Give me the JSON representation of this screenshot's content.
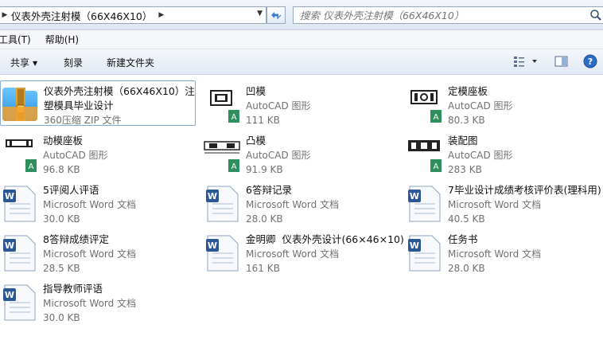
{
  "address": {
    "path_label": "仪表外壳注射模（66X46X10）",
    "search_placeholder": "搜索 仪表外壳注射模（66X46X10）"
  },
  "menu": [
    {
      "label": "工具(T)"
    },
    {
      "label": "帮助(H)"
    }
  ],
  "commands": {
    "share": "共享",
    "burn": "刻录",
    "new_folder": "新建文件夹"
  },
  "files": [
    {
      "name": "仪表外壳注射模（66X46X10）注塑模具毕业设计",
      "type": "360压缩 ZIP 文件",
      "size": "",
      "icon": "zip-archive-icon"
    },
    {
      "name": "凹模",
      "type": "AutoCAD 图形",
      "size": "111 KB",
      "icon": "autocad-drawing-icon"
    },
    {
      "name": "定模座板",
      "type": "AutoCAD 图形",
      "size": "80.3 KB",
      "icon": "autocad-drawing-icon"
    },
    {
      "name": "动模座板",
      "type": "AutoCAD 图形",
      "size": "96.8 KB",
      "icon": "autocad-drawing-icon"
    },
    {
      "name": "凸模",
      "type": "AutoCAD 图形",
      "size": "91.9 KB",
      "icon": "autocad-drawing-icon"
    },
    {
      "name": "装配图",
      "type": "AutoCAD 图形",
      "size": "283 KB",
      "icon": "autocad-drawing-icon"
    },
    {
      "name": "5评阅人评语",
      "type": "Microsoft Word 文档",
      "size": "30.0 KB",
      "icon": "word-document-icon"
    },
    {
      "name": "6答辩记录",
      "type": "Microsoft Word 文档",
      "size": "28.0 KB",
      "icon": "word-document-icon"
    },
    {
      "name": "7毕业设计成绩考核评价表(理科用)",
      "type": "Microsoft Word 文档",
      "size": "40.5 KB",
      "icon": "word-document-icon"
    },
    {
      "name": "8答辩成绩评定",
      "type": "Microsoft Word 文档",
      "size": "28.5 KB",
      "icon": "word-document-icon"
    },
    {
      "name": "金明卿  仪表外壳设计(66×46×10)",
      "type": "Microsoft Word 文档",
      "size": "161 KB",
      "icon": "word-document-icon"
    },
    {
      "name": "任务书",
      "type": "Microsoft Word 文档",
      "size": "28.0 KB",
      "icon": "word-document-icon"
    },
    {
      "name": "指导教师评语",
      "type": "Microsoft Word 文档",
      "size": "30.0 KB",
      "icon": "word-document-icon"
    }
  ]
}
